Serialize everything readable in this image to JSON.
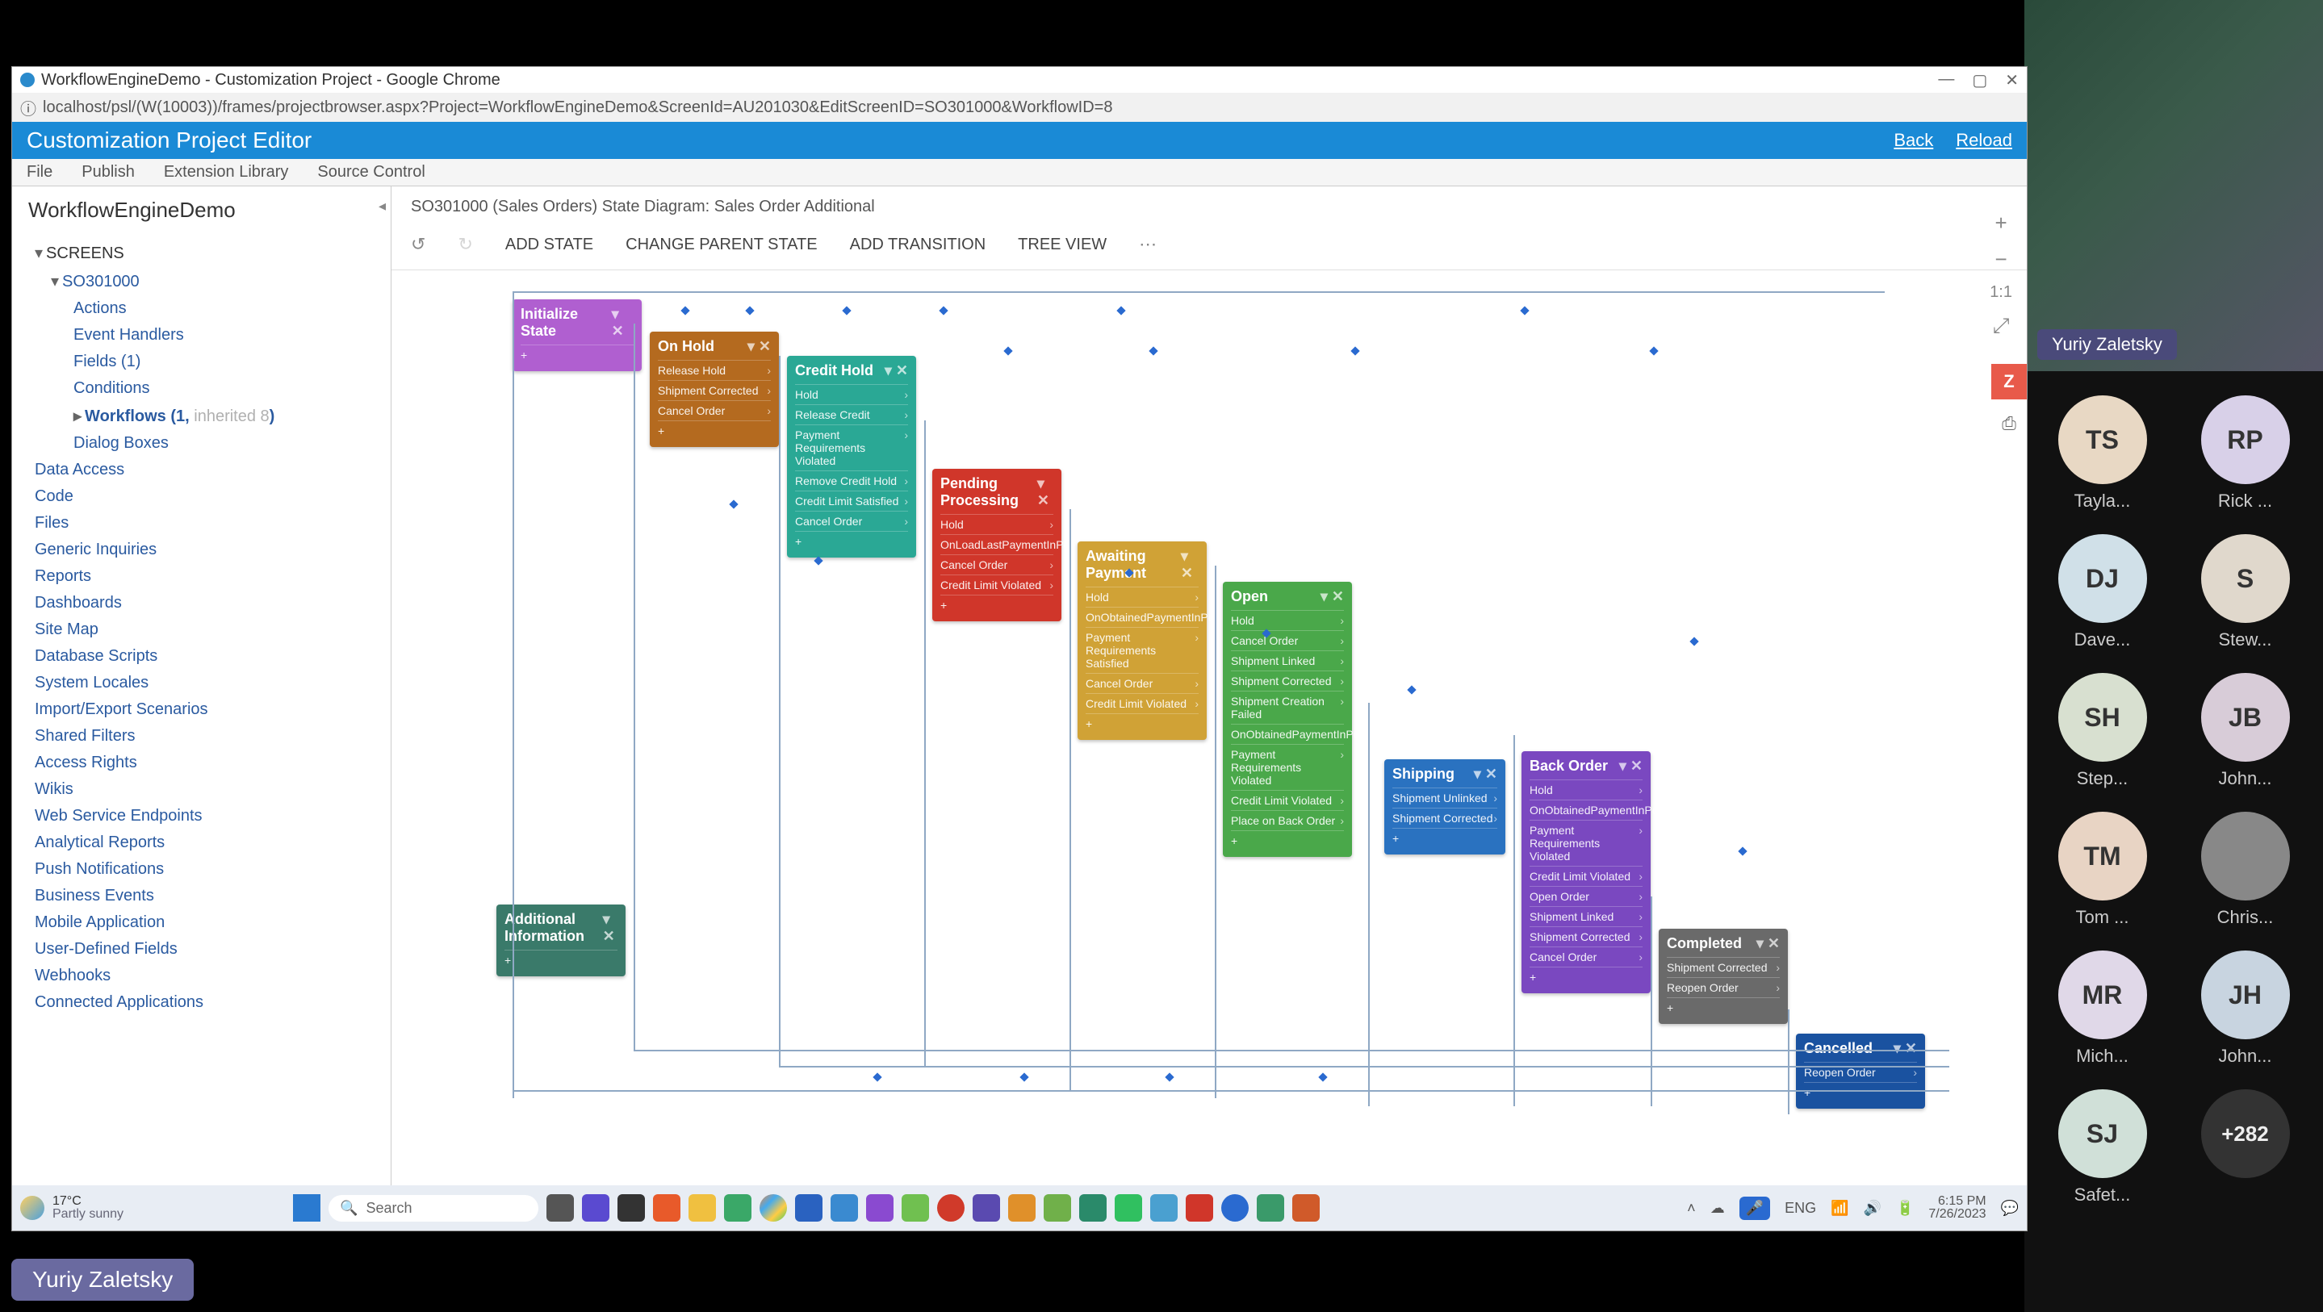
{
  "presenter_chip": "Yuriy Zaletsky",
  "call": {
    "main_name": "Yuriy Zaletsky",
    "participants": [
      {
        "initials": "TS",
        "name": "Tayla...",
        "bg": "#e8d8c4"
      },
      {
        "initials": "RP",
        "name": "Rick ...",
        "bg": "#d8d0e8"
      },
      {
        "initials": "DJ",
        "name": "Dave...",
        "bg": "#d0e0e8"
      },
      {
        "initials": "S",
        "name": "Stew...",
        "bg": "#e0d8cc"
      },
      {
        "initials": "SH",
        "name": "Step...",
        "bg": "#d8e0d0"
      },
      {
        "initials": "JB",
        "name": "John...",
        "bg": "#d8ccd8"
      },
      {
        "initials": "TM",
        "name": "Tom ...",
        "bg": "#e8d4c4"
      },
      {
        "initials": "",
        "name": "Chris...",
        "bg": "#888",
        "photo": true
      },
      {
        "initials": "MR",
        "name": "Mich...",
        "bg": "#e0d8e8"
      },
      {
        "initials": "JH",
        "name": "John...",
        "bg": "#c8d4e0"
      },
      {
        "initials": "SJ",
        "name": "Safet...",
        "bg": "#d0e0d8"
      }
    ],
    "more": "+282"
  },
  "chrome": {
    "tab_title": "WorkflowEngineDemo - Customization Project - Google Chrome",
    "url": "localhost/psl/(W(10003))/frames/projectbrowser.aspx?Project=WorkflowEngineDemo&ScreenId=AU201030&EditScreenID=SO301000&WorkflowID=8"
  },
  "app": {
    "title": "Customization Project Editor",
    "back": "Back",
    "reload": "Reload",
    "menu": [
      "File",
      "Publish",
      "Extension Library",
      "Source Control"
    ]
  },
  "tree": {
    "title": "WorkflowEngineDemo",
    "root": "SCREENS",
    "screen": "SO301000",
    "children": [
      "Actions",
      "Event Handlers",
      "Fields (1)",
      "Conditions"
    ],
    "workflows_label": "Workflows (1, ",
    "workflows_inh": "inherited 8",
    "workflows_tail": ")",
    "after": [
      "Dialog Boxes"
    ],
    "below": [
      "Data Access",
      "Code",
      "Files",
      "Generic Inquiries",
      "Reports",
      "Dashboards",
      "Site Map",
      "Database Scripts",
      "System Locales",
      "Import/Export Scenarios",
      "Shared Filters",
      "Access Rights",
      "Wikis",
      "Web Service Endpoints",
      "Analytical Reports",
      "Push Notifications",
      "Business Events",
      "Mobile Application",
      "User-Defined Fields",
      "Webhooks",
      "Connected Applications"
    ]
  },
  "breadcrumb": "SO301000 (Sales Orders) State Diagram: Sales Order Additional",
  "toolbar": {
    "undo": "↺",
    "redo": "↻",
    "items": [
      "ADD STATE",
      "CHANGE PARENT STATE",
      "ADD TRANSITION",
      "TREE VIEW"
    ],
    "more": "⋯"
  },
  "zoom": {
    "plus": "+",
    "minus": "−",
    "fit": "1:1",
    "arrows": "⤢"
  },
  "side": {
    "z": "Z",
    "print": "⎙"
  },
  "states": {
    "init": {
      "title": "Initialize State",
      "rows": [
        "+"
      ]
    },
    "onhold": {
      "title": "On Hold",
      "rows": [
        "Release Hold",
        "Shipment Corrected",
        "Cancel Order",
        "+"
      ]
    },
    "credhold": {
      "title": "Credit Hold",
      "rows": [
        "Hold",
        "Release Credit",
        "Payment Requirements Violated",
        "Remove Credit Hold",
        "Credit Limit Satisfied",
        "Cancel Order",
        "+"
      ]
    },
    "pending": {
      "title": "Pending Processing",
      "rows": [
        "Hold",
        "OnLoadLastPaymentInPendingProcessing",
        "Cancel Order",
        "Credit Limit Violated",
        "+"
      ]
    },
    "await": {
      "title": "Awaiting Payment",
      "rows": [
        "Hold",
        "OnObtainedPaymentInPendingProcessing",
        "Payment Requirements Satisfied",
        "Cancel Order",
        "Credit Limit Violated",
        "+"
      ]
    },
    "open": {
      "title": "Open",
      "rows": [
        "Hold",
        "Cancel Order",
        "Shipment Linked",
        "Shipment Corrected",
        "Shipment Creation Failed",
        "OnObtainedPaymentInPendingProcessing",
        "Payment Requirements Violated",
        "Credit Limit Violated",
        "Place on Back Order",
        "+"
      ]
    },
    "shipping": {
      "title": "Shipping",
      "rows": [
        "Shipment Unlinked",
        "Shipment Corrected",
        "+"
      ]
    },
    "backorder": {
      "title": "Back Order",
      "rows": [
        "Hold",
        "OnObtainedPaymentInPendingProcessing",
        "Payment Requirements Violated",
        "Credit Limit Violated",
        "Open Order",
        "Shipment Linked",
        "Shipment Corrected",
        "Cancel Order",
        "+"
      ]
    },
    "completed": {
      "title": "Completed",
      "rows": [
        "Shipment Corrected",
        "Reopen Order",
        "+"
      ]
    },
    "cancelled": {
      "title": "Cancelled",
      "rows": [
        "Reopen Order",
        "+"
      ]
    },
    "addinfo": {
      "title": "Additional Information",
      "rows": [
        "+"
      ]
    }
  },
  "taskbar": {
    "temp": "17°C",
    "cond": "Partly sunny",
    "search": "Search",
    "lang": "ENG",
    "time": "6:15 PM",
    "date": "7/26/2023"
  }
}
